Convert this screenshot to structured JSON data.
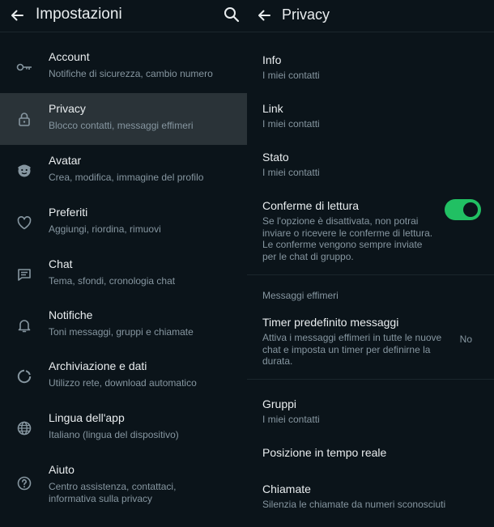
{
  "settings_panel": {
    "title": "Impostazioni",
    "items": [
      {
        "title": "Account",
        "subtitle": "Notifiche di sicurezza, cambio numero",
        "icon": "key-icon"
      },
      {
        "title": "Privacy",
        "subtitle": "Blocco contatti, messaggi effimeri",
        "icon": "lock-icon"
      },
      {
        "title": "Avatar",
        "subtitle": "Crea, modifica, immagine del profilo",
        "icon": "avatar-icon"
      },
      {
        "title": "Preferiti",
        "subtitle": "Aggiungi, riordina, rimuovi",
        "icon": "heart-icon"
      },
      {
        "title": "Chat",
        "subtitle": "Tema, sfondi, cronologia chat",
        "icon": "chat-icon"
      },
      {
        "title": "Notifiche",
        "subtitle": "Toni messaggi, gruppi e chiamate",
        "icon": "bell-icon"
      },
      {
        "title": "Archiviazione e dati",
        "subtitle": "Utilizzo rete, download automatico",
        "icon": "storage-icon"
      },
      {
        "title": "Lingua dell'app",
        "subtitle": "Italiano (lingua del dispositivo)",
        "icon": "globe-icon"
      },
      {
        "title": "Aiuto",
        "subtitle": "Centro assistenza, contattaci, informativa sulla privacy",
        "icon": "help-icon"
      }
    ]
  },
  "privacy_panel": {
    "title": "Privacy",
    "info": {
      "title": "Info",
      "subtitle": "I miei contatti"
    },
    "link": {
      "title": "Link",
      "subtitle": "I miei contatti"
    },
    "stato": {
      "title": "Stato",
      "subtitle": "I miei contatti"
    },
    "read_receipts": {
      "title": "Conferme di lettura",
      "subtitle": "Se l'opzione è disattivata, non potrai inviare o ricevere le conferme di lettura. Le conferme vengono sempre inviate per le chat di gruppo.",
      "enabled": true
    },
    "ephemeral_section_label": "Messaggi effimeri",
    "default_timer": {
      "title": "Timer predefinito messaggi",
      "subtitle": "Attiva i messaggi effimeri in tutte le nuove chat e imposta un timer per definirne la durata.",
      "value": "No"
    },
    "gruppi": {
      "title": "Gruppi",
      "subtitle": "I miei contatti"
    },
    "live_location": {
      "title": "Posizione in tempo reale"
    },
    "chiamate": {
      "title": "Chiamate",
      "subtitle": "Silenzia le chiamate da numeri sconosciuti"
    }
  },
  "colors": {
    "background": "#0b141a",
    "selected_row": "#2a3338",
    "accent_green": "#21c063",
    "secondary_text": "#8696a0"
  }
}
